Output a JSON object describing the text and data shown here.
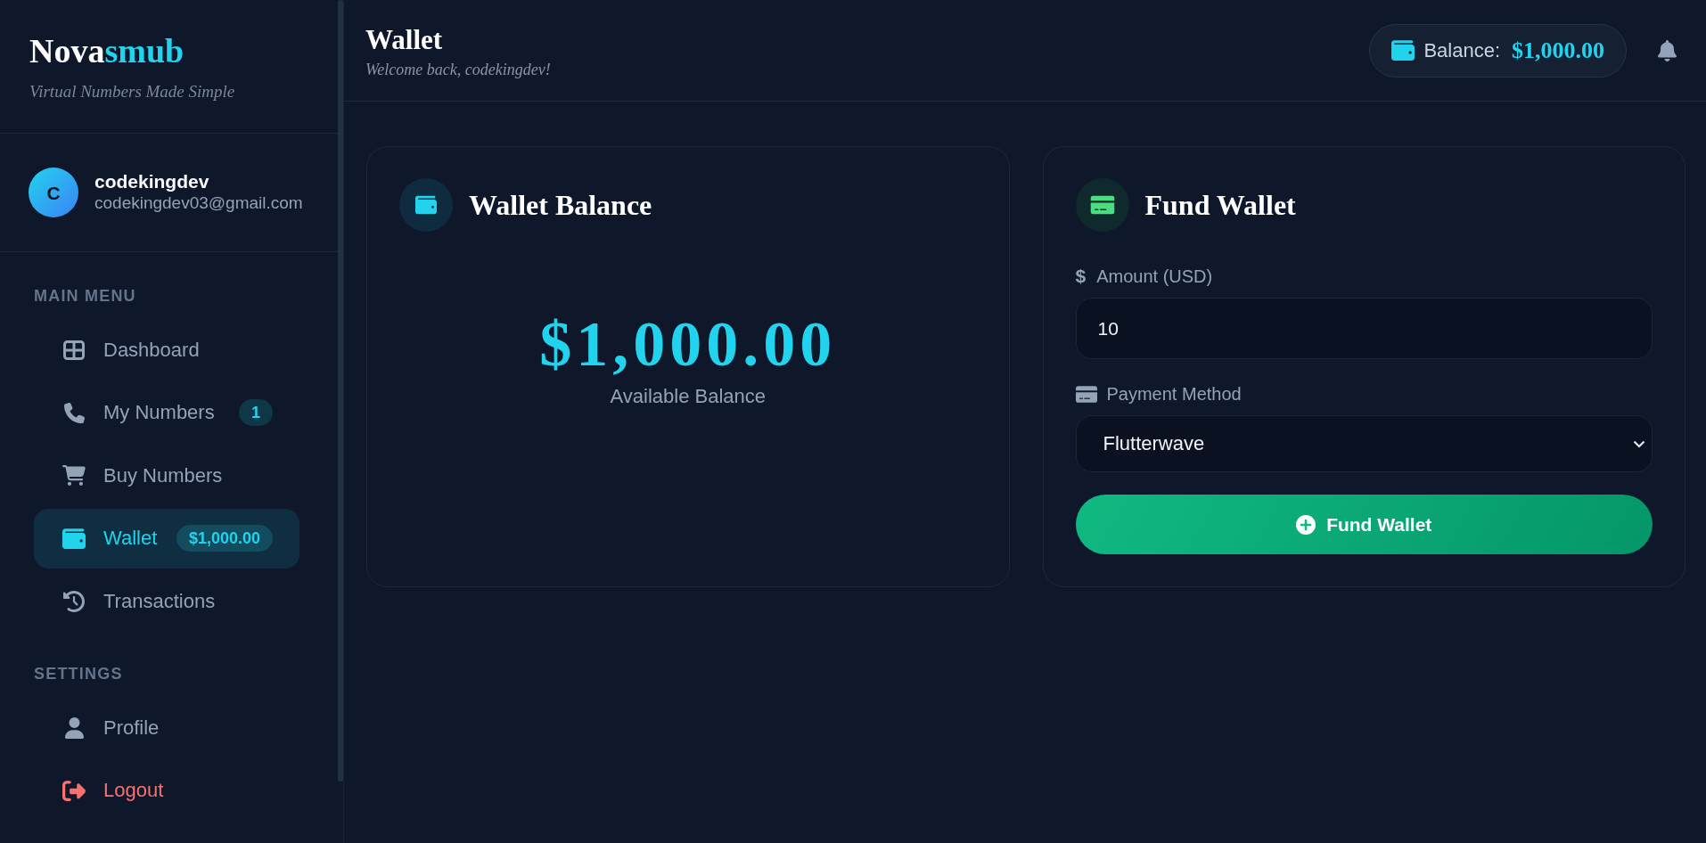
{
  "sidebar": {
    "logo": {
      "text": "Nova",
      "accent": "smub"
    },
    "tagline": "Virtual Numbers Made Simple",
    "user": {
      "initial": "C",
      "name": "codekingdev",
      "email": "codekingdev03@gmail.com"
    },
    "sections": [
      {
        "heading": "MAIN MENU",
        "items": [
          {
            "label": "Dashboard",
            "kind": "nav",
            "selected": false
          },
          {
            "label": "My Numbers",
            "kind": "nav",
            "selected": false,
            "badge": "1"
          },
          {
            "label": "Buy Numbers",
            "kind": "nav",
            "selected": false
          },
          {
            "label": "Wallet",
            "kind": "nav",
            "selected": true,
            "badge": "$1,000.00"
          },
          {
            "label": "Transactions",
            "kind": "nav",
            "selected": false
          }
        ]
      },
      {
        "heading": "SETTINGS",
        "items": [
          {
            "label": "Profile",
            "kind": "nav",
            "selected": false
          },
          {
            "label": "Logout",
            "kind": "danger",
            "selected": false
          }
        ]
      }
    ]
  },
  "header": {
    "title": "Wallet",
    "subtitle": "Welcome back, codekingdev!",
    "balance": {
      "label": "Balance:",
      "amount": "$1,000.00"
    }
  },
  "wallet_balance_card": {
    "title": "Wallet Balance",
    "amount": "$1,000.00",
    "caption": "Available Balance"
  },
  "fund_wallet_card": {
    "title": "Fund Wallet",
    "amount_field": {
      "symbol": "$",
      "label": "Amount (USD)",
      "value": "10"
    },
    "payment_method": {
      "label": "Payment Method",
      "value": "Flutterwave"
    },
    "button": "Fund Wallet"
  }
}
